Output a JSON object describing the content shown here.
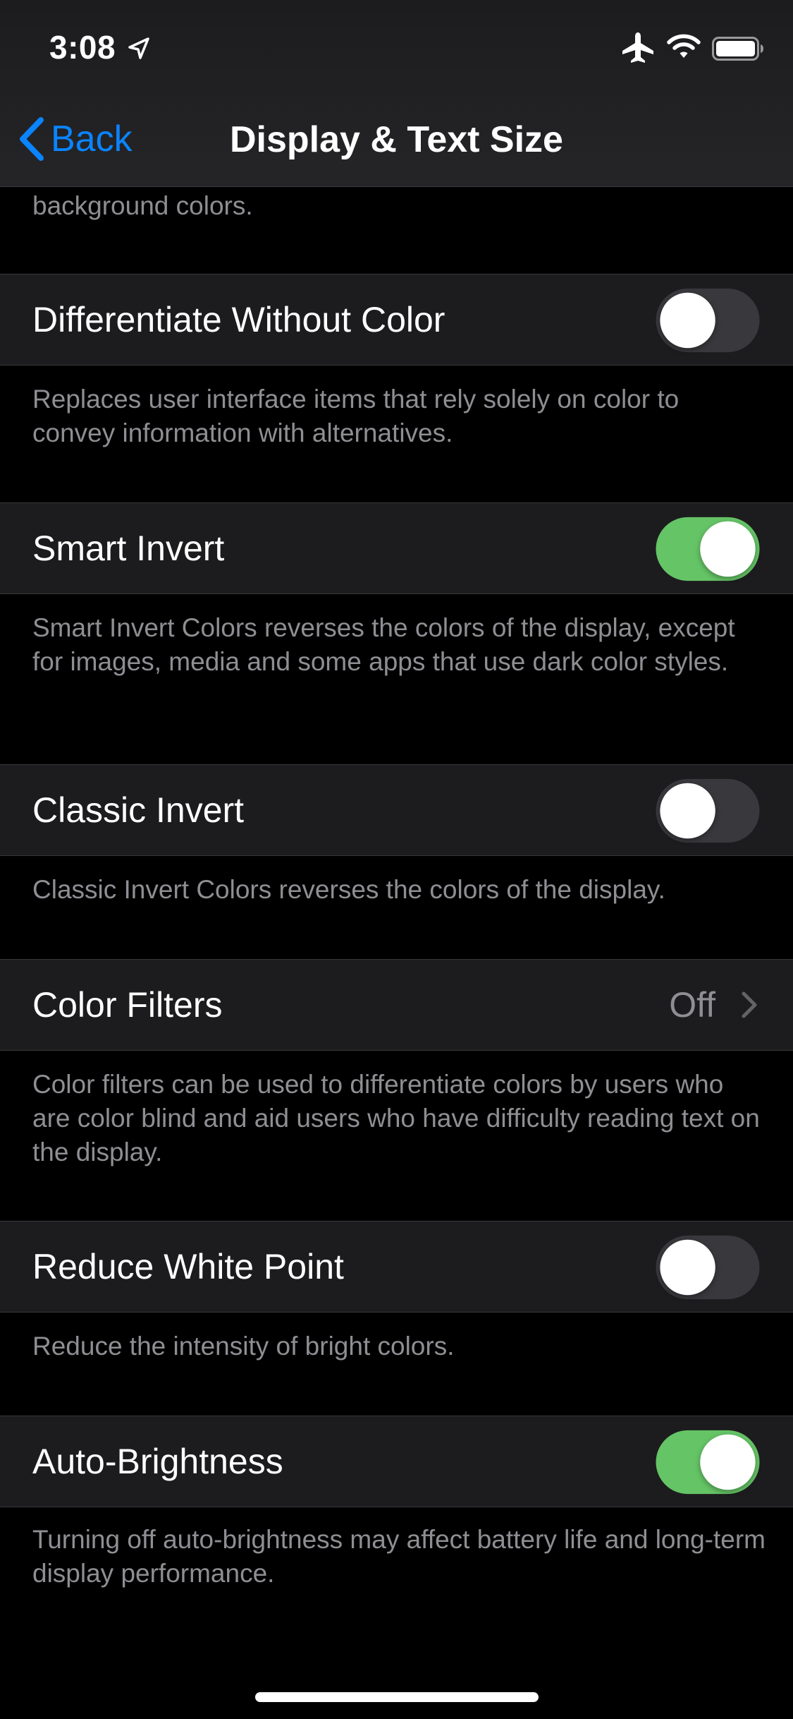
{
  "status_bar": {
    "time": "3:08",
    "icons": [
      "location-arrow-icon",
      "airplane-icon",
      "wifi-icon",
      "battery-icon"
    ]
  },
  "nav": {
    "back_label": "Back",
    "title": "Display & Text Size"
  },
  "colors": {
    "accent": "#0a84ff",
    "toggle_on": "#65c466",
    "toggle_off": "#39393d",
    "row_bg": "#1c1c1e",
    "footer_text": "#8e8e93"
  },
  "partial_footer": "background colors.",
  "settings": [
    {
      "label": "Differentiate Without Color",
      "type": "toggle",
      "on": false,
      "footer": "Replaces user interface items that rely solely on color to convey information with alternatives."
    },
    {
      "label": "Smart Invert",
      "type": "toggle",
      "on": true,
      "footer": "Smart Invert Colors reverses the colors of the display, except for images, media and some apps that use dark color styles."
    },
    {
      "label": "Classic Invert",
      "type": "toggle",
      "on": false,
      "footer": "Classic Invert Colors reverses the colors of the display."
    },
    {
      "label": "Color Filters",
      "type": "disclosure",
      "value": "Off",
      "footer": "Color filters can be used to differentiate colors by users who are color blind and aid users who have difficulty reading text on the display."
    },
    {
      "label": "Reduce White Point",
      "type": "toggle",
      "on": false,
      "footer": "Reduce the intensity of bright colors."
    },
    {
      "label": "Auto-Brightness",
      "type": "toggle",
      "on": true,
      "footer": "Turning off auto-brightness may affect battery life and long-term display performance."
    }
  ]
}
